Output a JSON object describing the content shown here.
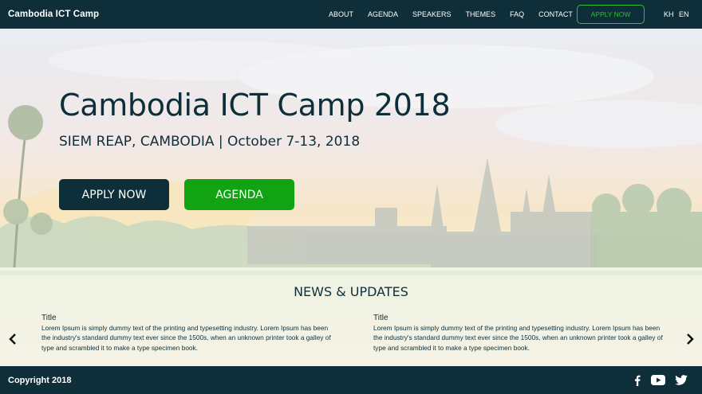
{
  "navbar": {
    "brand": "Cambodia ICT Camp",
    "links": [
      "ABOUT",
      "AGENDA",
      "SPEAKERS",
      "THEMES",
      "FAQ",
      "CONTACT"
    ],
    "cta": "APPLY NOW",
    "languages": [
      "KH",
      "EN"
    ]
  },
  "hero": {
    "title": "Cambodia ICT Camp 2018",
    "subtitle": "SIEM REAP, CAMBODIA | October 7-13, 2018",
    "apply_button": "APPLY NOW",
    "agenda_button": "AGENDA"
  },
  "news": {
    "heading": "NEWS & UPDATES",
    "items": [
      {
        "title": "Title",
        "body": "Lorem Ipsum is simply dummy text of the printing and typesetting industry. Lorem Ipsum has been the industry's standard dummy text ever since the 1500s, when an unknown printer took a galley of type and scrambled it to make a type specimen book."
      },
      {
        "title": "Title",
        "body": "Lorem Ipsum is simply dummy text of the printing and typesetting industry. Lorem Ipsum has been the industry's standard dummy text ever since the 1500s, when an unknown printer took a galley of type and scrambled it to make a type specimen book."
      }
    ]
  },
  "footer": {
    "copyright": "Copyright 2018",
    "social_icons": [
      "facebook-icon",
      "youtube-icon",
      "twitter-icon"
    ]
  },
  "colors": {
    "primary_dark": "#0e2f3a",
    "accent_green": "#12a312",
    "outline_green": "#2fbf2f"
  }
}
